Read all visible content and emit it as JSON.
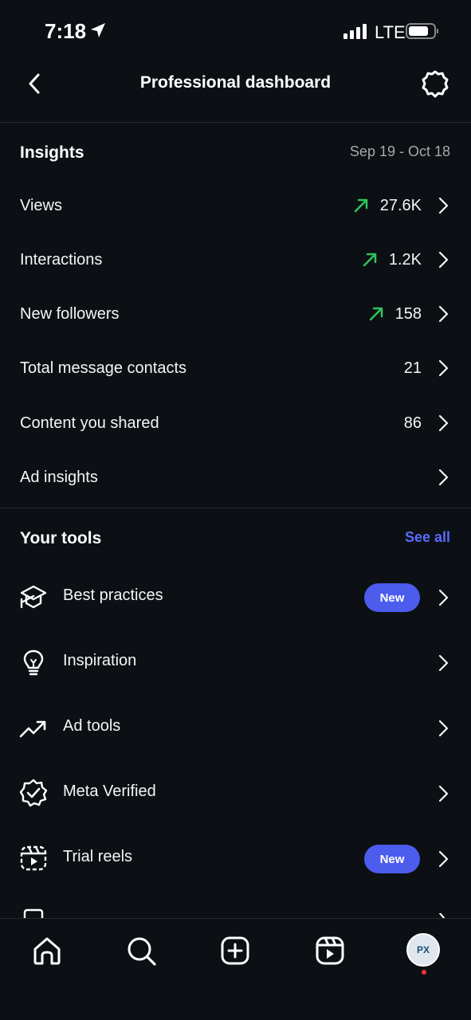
{
  "status": {
    "time": "7:18",
    "network": "LTE"
  },
  "header": {
    "title": "Professional dashboard"
  },
  "insights": {
    "title": "Insights",
    "date_range": "Sep 19 - Oct 18",
    "rows": [
      {
        "label": "Views",
        "value": "27.6K",
        "trend": "up"
      },
      {
        "label": "Interactions",
        "value": "1.2K",
        "trend": "up"
      },
      {
        "label": "New followers",
        "value": "158",
        "trend": "up"
      },
      {
        "label": "Total message contacts",
        "value": "21",
        "trend": ""
      },
      {
        "label": "Content you shared",
        "value": "86",
        "trend": ""
      },
      {
        "label": "Ad insights",
        "value": "",
        "trend": ""
      }
    ]
  },
  "tools": {
    "title": "Your tools",
    "see_all": "See all",
    "items": [
      {
        "label": "Best practices",
        "badge": "New",
        "icon": "graduation-cap-icon"
      },
      {
        "label": "Inspiration",
        "badge": "",
        "icon": "lightbulb-icon"
      },
      {
        "label": "Ad tools",
        "badge": "",
        "icon": "trend-up-icon"
      },
      {
        "label": "Meta Verified",
        "badge": "",
        "icon": "verified-badge-icon"
      },
      {
        "label": "Trial reels",
        "badge": "New",
        "icon": "trial-reels-icon"
      }
    ]
  },
  "colors": {
    "background": "#0c1014",
    "accent": "#4c5ced",
    "link": "#5a6bff",
    "trend_up": "#2fc55a"
  },
  "nav": {
    "items": [
      "home-icon",
      "search-icon",
      "create-icon",
      "reels-icon",
      "profile-avatar"
    ],
    "avatar_text": "PX"
  }
}
